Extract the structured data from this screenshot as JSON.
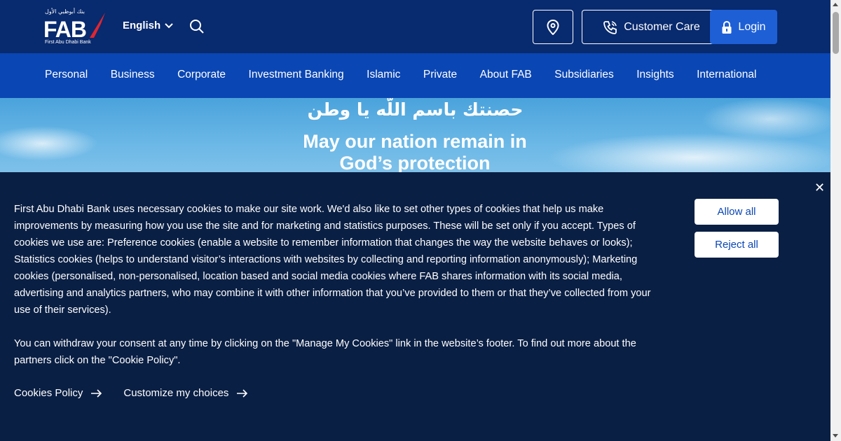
{
  "header": {
    "logo": {
      "arabic_text": "بنك أبوظبي الأول",
      "mark": "FAB",
      "subtitle": "First Abu Dhabi Bank"
    },
    "language": "English",
    "search_icon": "search-icon",
    "location_icon": "map-pin-icon",
    "customer_care_label": "Customer Care",
    "customer_care_icon": "phone-icon",
    "login_label": "Login",
    "login_icon": "lock-icon"
  },
  "nav": {
    "items": [
      {
        "label": "Personal"
      },
      {
        "label": "Business"
      },
      {
        "label": "Corporate"
      },
      {
        "label": "Investment Banking"
      },
      {
        "label": "Islamic"
      },
      {
        "label": "Private"
      },
      {
        "label": "About FAB"
      },
      {
        "label": "Subsidiaries"
      },
      {
        "label": "Insights"
      },
      {
        "label": "International"
      }
    ]
  },
  "hero": {
    "arabic_title": "حصنتك باسم اللّه يا وطن",
    "english_title": "May our nation remain in God’s protection"
  },
  "cookie_banner": {
    "paragraph1": "First Abu Dhabi Bank uses necessary cookies to make our site work. We'd also like to set other types of cookies that help us make improvements by measuring how you use the site and for marketing and statistics purposes. These will be set only if you accept. Types of cookies we use are: Preference cookies (enable a website to remember information that changes the way the website behaves or looks); Statistics cookies (helps to understand visitor’s interactions with websites by collecting and reporting information anonymously); Marketing cookies (personalised, non-personalised, location based and social media cookies where FAB shares information with its social media, advertising and analytics partners, who may combine it with other information that you’ve provided to them or that they’ve collected from your use of their services).",
    "paragraph2": "You can withdraw your consent at any time by clicking on the \"Manage My Cookies\" link in the website’s footer. To find out more about the partners click on the \"Cookie Policy\".",
    "allow_all_label": "Allow all",
    "reject_all_label": "Reject all",
    "cookies_policy_label": "Cookies Policy",
    "customize_label": "Customize my choices",
    "close_glyph": "✕"
  },
  "colors": {
    "topbar": "#082a6e",
    "nav": "#0a46b4",
    "login": "#1e5fd6",
    "logo_accent": "#e0262f",
    "banner": "#0a1f44"
  }
}
